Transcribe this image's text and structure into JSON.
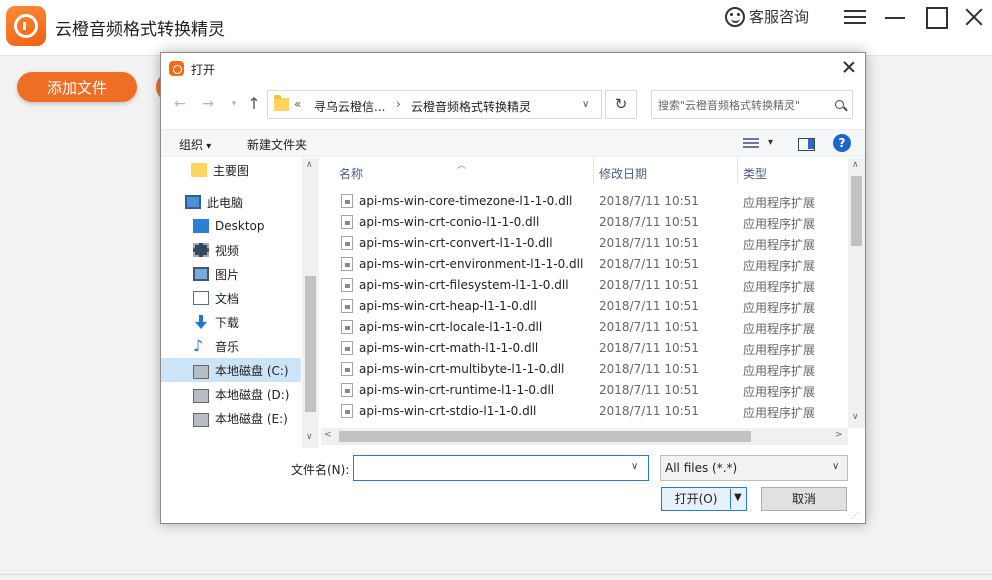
{
  "app": {
    "title": "云橙音频格式转换精灵",
    "support_label": "客服咨询",
    "add_file_label": "添加文件",
    "accent_color": "#ee6e26"
  },
  "dialog": {
    "title": "打开",
    "address": {
      "prefix": "«",
      "crumbs": [
        "寻乌云橙信...",
        "云橙音频格式转换精灵"
      ],
      "separator": "›"
    },
    "search": {
      "placeholder": "搜索\"云橙音频格式转换精灵\""
    },
    "toolbar": {
      "organize": "组织",
      "new_folder": "新建文件夹"
    },
    "nav": {
      "items": [
        {
          "label": "主要图",
          "icon": "folder-icon"
        },
        {
          "label": "此电脑",
          "icon": "computer-icon"
        },
        {
          "label": "Desktop",
          "icon": "desktop-icon"
        },
        {
          "label": "视频",
          "icon": "video-icon"
        },
        {
          "label": "图片",
          "icon": "picture-icon"
        },
        {
          "label": "文档",
          "icon": "document-icon"
        },
        {
          "label": "下载",
          "icon": "download-icon"
        },
        {
          "label": "音乐",
          "icon": "music-icon"
        },
        {
          "label": "本地磁盘 (C:)",
          "icon": "disk-icon",
          "selected": true
        },
        {
          "label": "本地磁盘 (D:)",
          "icon": "disk-icon"
        },
        {
          "label": "本地磁盘 (E:)",
          "icon": "disk-icon"
        }
      ]
    },
    "columns": {
      "name": "名称",
      "modified": "修改日期",
      "type": "类型"
    },
    "files": [
      {
        "name": "api-ms-win-core-timezone-l1-1-0.dll",
        "date": "2018/7/11 10:51",
        "type": "应用程序扩展"
      },
      {
        "name": "api-ms-win-crt-conio-l1-1-0.dll",
        "date": "2018/7/11 10:51",
        "type": "应用程序扩展"
      },
      {
        "name": "api-ms-win-crt-convert-l1-1-0.dll",
        "date": "2018/7/11 10:51",
        "type": "应用程序扩展"
      },
      {
        "name": "api-ms-win-crt-environment-l1-1-0.dll",
        "date": "2018/7/11 10:51",
        "type": "应用程序扩展"
      },
      {
        "name": "api-ms-win-crt-filesystem-l1-1-0.dll",
        "date": "2018/7/11 10:51",
        "type": "应用程序扩展"
      },
      {
        "name": "api-ms-win-crt-heap-l1-1-0.dll",
        "date": "2018/7/11 10:51",
        "type": "应用程序扩展"
      },
      {
        "name": "api-ms-win-crt-locale-l1-1-0.dll",
        "date": "2018/7/11 10:51",
        "type": "应用程序扩展"
      },
      {
        "name": "api-ms-win-crt-math-l1-1-0.dll",
        "date": "2018/7/11 10:51",
        "type": "应用程序扩展"
      },
      {
        "name": "api-ms-win-crt-multibyte-l1-1-0.dll",
        "date": "2018/7/11 10:51",
        "type": "应用程序扩展"
      },
      {
        "name": "api-ms-win-crt-runtime-l1-1-0.dll",
        "date": "2018/7/11 10:51",
        "type": "应用程序扩展"
      },
      {
        "name": "api-ms-win-crt-stdio-l1-1-0.dll",
        "date": "2018/7/11 10:51",
        "type": "应用程序扩展"
      }
    ],
    "filename": {
      "label": "文件名(N):",
      "value": ""
    },
    "filter": {
      "selected": "All files (*.*)"
    },
    "buttons": {
      "open": "打开(O)",
      "cancel": "取消"
    }
  }
}
